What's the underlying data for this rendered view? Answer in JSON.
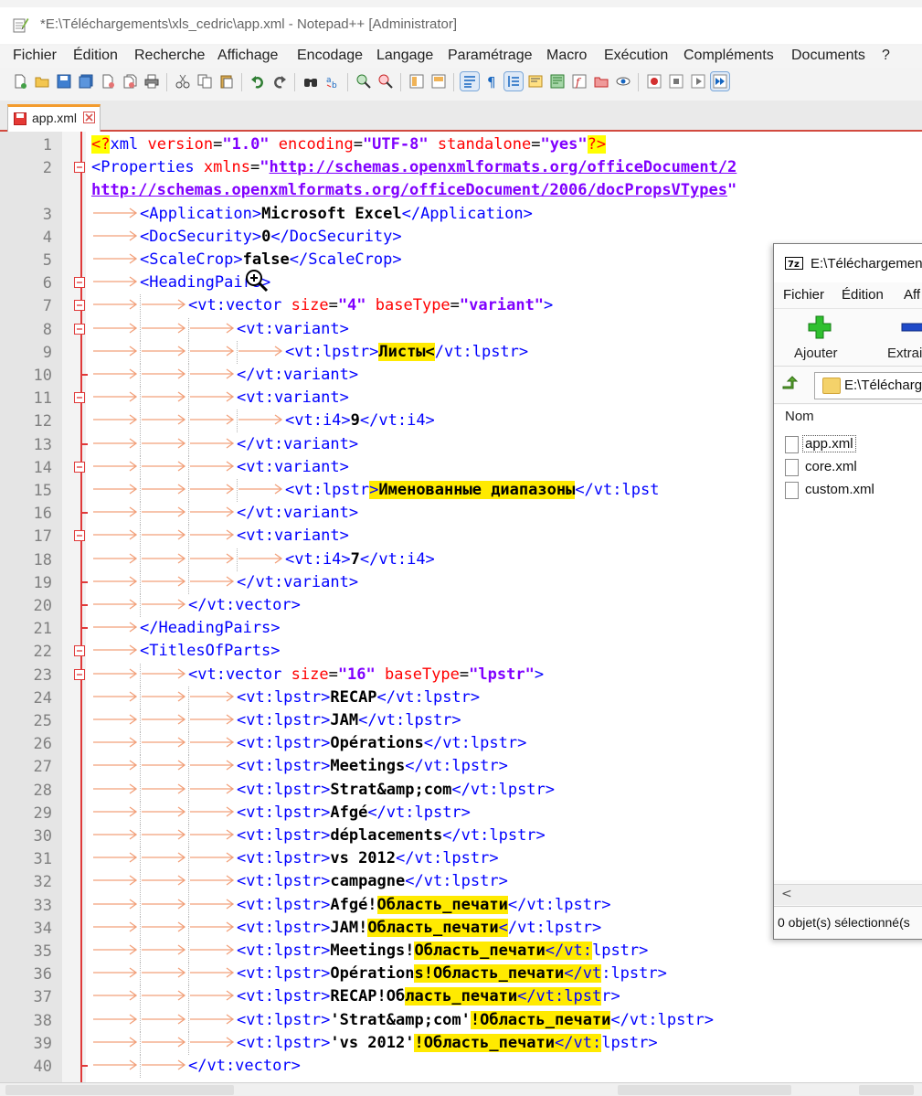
{
  "window": {
    "title": "*E:\\Téléchargements\\xls_cedric\\app.xml - Notepad++ [Administrator]"
  },
  "menu": [
    "Fichier",
    "Édition",
    "Recherche",
    "Affichage",
    "Encodage",
    "Langage",
    "Paramétrage",
    "Macro",
    "Exécution",
    "Compléments",
    "Documents",
    "?"
  ],
  "tab": {
    "name": "app.xml"
  },
  "editor": {
    "lines": [
      {
        "n": "1",
        "html": "<span class=\"pi\">&lt;?</span><span class=\"tag\">xml</span> <span class=\"attr\">version</span>=<span class=\"val\">\"1.0\"</span> <span class=\"attr\">encoding</span>=<span class=\"val\">\"UTF-8\"</span> <span class=\"attr\">standalone</span>=<span class=\"val\">\"yes\"</span><span class=\"pi\">?&gt;</span>"
      },
      {
        "n": "2",
        "html": "<span class=\"tag\">&lt;Properties</span> <span class=\"attr\">xmlns</span>=<span class=\"val\">\"</span><span class=\"url\">http://schemas.openxmlformats.org/officeDocument/2</span>"
      },
      {
        "n": "",
        "html": "<span class=\"url\">http://schemas.openxmlformats.org/officeDocument/2006/docPropsVTypes</span><span class=\"val\">\"</span>"
      },
      {
        "n": "3",
        "html": "<span class=\"tag\">&lt;Application&gt;</span><span class=\"txt\">Microsoft Excel</span><span class=\"tag\">&lt;/Application&gt;</span>"
      },
      {
        "n": "4",
        "html": "<span class=\"tag\">&lt;DocSecurity&gt;</span><span class=\"txt\">0</span><span class=\"tag\">&lt;/DocSecurity&gt;</span>"
      },
      {
        "n": "5",
        "html": "<span class=\"tag\">&lt;ScaleCrop&gt;</span><span class=\"txt\">false</span><span class=\"tag\">&lt;/ScaleCrop&gt;</span>"
      },
      {
        "n": "6",
        "html": "<span class=\"tag\">&lt;HeadingPairs&gt;</span>"
      },
      {
        "n": "7",
        "html": "<span class=\"tag\">&lt;vt:vector</span> <span class=\"attr\">size</span>=<span class=\"val\">\"4\"</span> <span class=\"attr\">baseType</span>=<span class=\"val\">\"variant\"</span><span class=\"tag\">&gt;</span>"
      },
      {
        "n": "8",
        "html": "<span class=\"tag\">&lt;vt:variant&gt;</span>"
      },
      {
        "n": "9",
        "html": "<span class=\"tag\">&lt;vt:lpstr&gt;</span><span class=\"txt hl\">Листы&lt;</span><span class=\"tag\">/vt:lpstr&gt;</span>"
      },
      {
        "n": "10",
        "html": "<span class=\"tag\">&lt;/vt:variant&gt;</span>"
      },
      {
        "n": "11",
        "html": "<span class=\"tag\">&lt;vt:variant&gt;</span>"
      },
      {
        "n": "12",
        "html": "<span class=\"tag\">&lt;vt:i4&gt;</span><span class=\"txt\">9</span><span class=\"tag\">&lt;/vt:i4&gt;</span>"
      },
      {
        "n": "13",
        "html": "<span class=\"tag\">&lt;/vt:variant&gt;</span>"
      },
      {
        "n": "14",
        "html": "<span class=\"tag\">&lt;vt:variant&gt;</span>"
      },
      {
        "n": "15",
        "html": "<span class=\"tag\">&lt;vt:lpstr</span><span class=\"tag hl\">&gt;</span><span class=\"txt hl\">Именованные диапазоны</span><span class=\"tag\">&lt;/vt:lpst</span>"
      },
      {
        "n": "16",
        "html": "<span class=\"tag\">&lt;/vt:variant&gt;</span>"
      },
      {
        "n": "17",
        "html": "<span class=\"tag\">&lt;vt:variant&gt;</span>"
      },
      {
        "n": "18",
        "html": "<span class=\"tag\">&lt;vt:i4&gt;</span><span class=\"txt\">7</span><span class=\"tag\">&lt;/vt:i4&gt;</span>"
      },
      {
        "n": "19",
        "html": "<span class=\"tag\">&lt;/vt:variant&gt;</span>"
      },
      {
        "n": "20",
        "html": "<span class=\"tag\">&lt;/vt:vector&gt;</span>"
      },
      {
        "n": "21",
        "html": "<span class=\"tag\">&lt;/HeadingPairs&gt;</span>"
      },
      {
        "n": "22",
        "html": "<span class=\"tag\">&lt;TitlesOfParts&gt;</span>"
      },
      {
        "n": "23",
        "html": "<span class=\"tag\">&lt;vt:vector</span> <span class=\"attr\">size</span>=<span class=\"val\">\"16\"</span> <span class=\"attr\">baseType</span>=<span class=\"val\">\"lpstr\"</span><span class=\"tag\">&gt;</span>"
      },
      {
        "n": "24",
        "html": "<span class=\"tag\">&lt;vt:lpstr&gt;</span><span class=\"txt\">RECAP</span><span class=\"tag\">&lt;/vt:lpstr&gt;</span>"
      },
      {
        "n": "25",
        "html": "<span class=\"tag\">&lt;vt:lpstr&gt;</span><span class=\"txt\">JAM</span><span class=\"tag\">&lt;/vt:lpstr&gt;</span>"
      },
      {
        "n": "26",
        "html": "<span class=\"tag\">&lt;vt:lpstr&gt;</span><span class=\"txt\">Opérations</span><span class=\"tag\">&lt;/vt:lpstr&gt;</span>"
      },
      {
        "n": "27",
        "html": "<span class=\"tag\">&lt;vt:lpstr&gt;</span><span class=\"txt\">Meetings</span><span class=\"tag\">&lt;/vt:lpstr&gt;</span>"
      },
      {
        "n": "28",
        "html": "<span class=\"tag\">&lt;vt:lpstr&gt;</span><span class=\"txt\">Strat&amp;amp;com</span><span class=\"tag\">&lt;/vt:lpstr&gt;</span>"
      },
      {
        "n": "29",
        "html": "<span class=\"tag\">&lt;vt:lpstr&gt;</span><span class=\"txt\">Afgé</span><span class=\"tag\">&lt;/vt:lpstr&gt;</span>"
      },
      {
        "n": "30",
        "html": "<span class=\"tag\">&lt;vt:lpstr&gt;</span><span class=\"txt\">déplacements</span><span class=\"tag\">&lt;/vt:lpstr&gt;</span>"
      },
      {
        "n": "31",
        "html": "<span class=\"tag\">&lt;vt:lpstr&gt;</span><span class=\"txt\">vs 2012</span><span class=\"tag\">&lt;/vt:lpstr&gt;</span>"
      },
      {
        "n": "32",
        "html": "<span class=\"tag\">&lt;vt:lpstr&gt;</span><span class=\"txt\">campagne</span><span class=\"tag\">&lt;/vt:lpstr&gt;</span>"
      },
      {
        "n": "33",
        "html": "<span class=\"tag\">&lt;vt:lpstr&gt;</span><span class=\"txt\">Afgé!</span><span class=\"txt hl\">Область_печати</span><span class=\"tag\">&lt;/vt:lpstr&gt;</span>"
      },
      {
        "n": "34",
        "html": "<span class=\"tag\">&lt;vt:lpstr&gt;</span><span class=\"txt\">JAM!</span><span class=\"txt hl\">Область_печати</span><span class=\"tag hl\">&lt;</span><span class=\"tag\">/vt:lpstr&gt;</span>"
      },
      {
        "n": "35",
        "html": "<span class=\"tag\">&lt;vt:lpstr&gt;</span><span class=\"txt\">Meetings!</span><span class=\"txt hl\">Область_печати</span><span class=\"tag hl\">&lt;/vt:</span><span class=\"tag\">lpstr&gt;</span>"
      },
      {
        "n": "36",
        "html": "<span class=\"tag\">&lt;vt:lpstr&gt;</span><span class=\"txt\">Opération</span><span class=\"txt hl\">s!Область_печати</span><span class=\"tag hl\">&lt;/vt</span><span class=\"tag\">:lpstr&gt;</span>"
      },
      {
        "n": "37",
        "html": "<span class=\"tag\">&lt;vt:lpstr&gt;</span><span class=\"txt\">RECAP!Об</span><span class=\"txt hl\">ласть_печати</span><span class=\"tag hl\">&lt;/vt:lpst</span><span class=\"tag\">r&gt;</span>"
      },
      {
        "n": "38",
        "html": "<span class=\"tag\">&lt;vt:lpstr&gt;</span><span class=\"txt\">'Strat&amp;amp;com'</span><span class=\"txt hl\">!Область_печати</span><span class=\"tag\">&lt;/vt:lpstr&gt;</span>"
      },
      {
        "n": "39",
        "html": "<span class=\"tag\">&lt;vt:lpstr&gt;</span><span class=\"txt\">'vs 2012'</span><span class=\"txt hl\">!Область_печати</span><span class=\"tag hl\">&lt;/vt:</span><span class=\"tag\">lpstr&gt;</span>"
      },
      {
        "n": "40",
        "html": "<span class=\"tag\">&lt;/vt:vector&gt;</span>"
      }
    ]
  },
  "sevenzip": {
    "title": "E:\\Téléchargemen",
    "menu": [
      "Fichier",
      "Édition",
      "Aff"
    ],
    "add_label": "Ajouter",
    "extract_label": "Extrai",
    "path": "E:\\Télécharg",
    "column_name": "Nom",
    "files": [
      "app.xml",
      "core.xml",
      "custom.xml"
    ],
    "scroll_left": "<",
    "status": "0 objet(s) sélectionné(s"
  },
  "colors": {
    "accent": "#f39b2d",
    "highlight": "#ffea00",
    "fold": "#e03a3a"
  }
}
